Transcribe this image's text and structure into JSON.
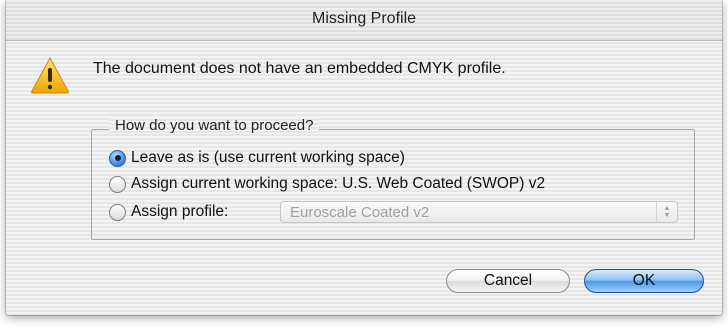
{
  "dialog": {
    "title": "Missing Profile",
    "message": "The document does not have an embedded CMYK profile.",
    "warning_icon": "warning-triangle-icon",
    "group": {
      "legend": "How do you want to proceed?",
      "options": [
        {
          "label": "Leave as is (use current working space)",
          "selected": true
        },
        {
          "label": "Assign current working space:  U.S. Web Coated (SWOP) v2",
          "selected": false
        },
        {
          "label": "Assign profile:",
          "selected": false
        }
      ],
      "profile_select": {
        "value": "Euroscale Coated v2",
        "enabled": false
      }
    },
    "buttons": {
      "cancel": "Cancel",
      "ok": "OK"
    },
    "colors": {
      "accent": "#4f96e3",
      "warning": "#f2b01e"
    }
  }
}
